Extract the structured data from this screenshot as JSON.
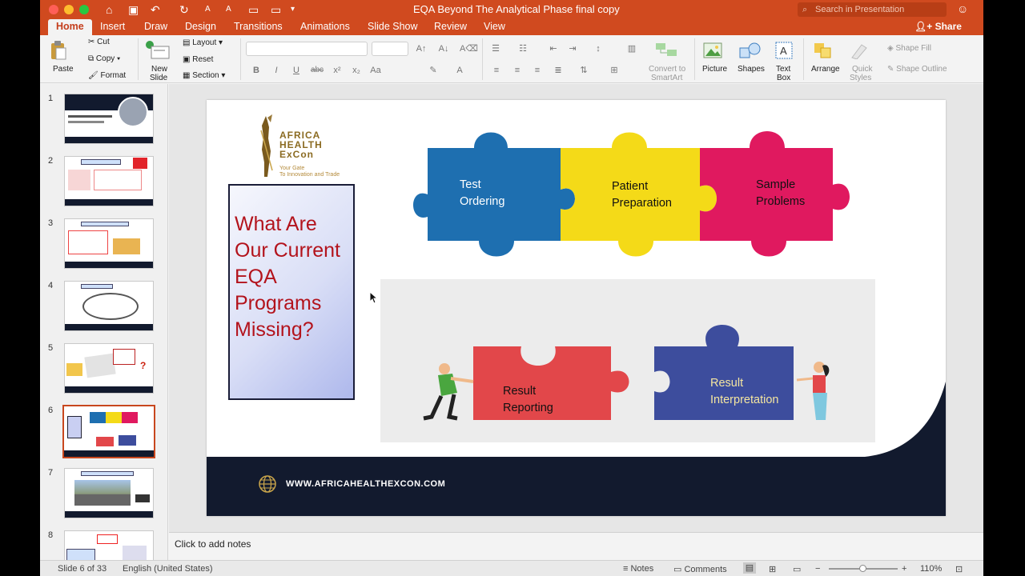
{
  "window": {
    "title": "EQA Beyond The Analytical Phase final copy",
    "search_placeholder": "Search in Presentation",
    "share_label": "Share"
  },
  "tabs": [
    "Home",
    "Insert",
    "Draw",
    "Design",
    "Transitions",
    "Animations",
    "Slide Show",
    "Review",
    "View"
  ],
  "active_tab": "Home",
  "ribbon": {
    "paste": "Paste",
    "cut": "Cut",
    "copy": "Copy",
    "format": "Format",
    "new_slide_1": "New",
    "new_slide_2": "Slide",
    "layout": "Layout",
    "reset": "Reset",
    "section": "Section",
    "convert_1": "Convert to",
    "convert_2": "SmartArt",
    "picture": "Picture",
    "shapes": "Shapes",
    "textbox_1": "Text",
    "textbox_2": "Box",
    "arrange": "Arrange",
    "quick_styles_1": "Quick",
    "quick_styles_2": "Styles",
    "shape_fill": "Shape Fill",
    "shape_outline": "Shape Outline"
  },
  "thumbnails": {
    "numbers": [
      "1",
      "2",
      "3",
      "4",
      "5",
      "6",
      "7",
      "8"
    ],
    "selected": "6"
  },
  "slide": {
    "logo_line1": "AFRICA",
    "logo_line2": "HEALTH",
    "logo_line3": "ExCon",
    "logo_tag1": "Your Gate",
    "logo_tag2": "To Innovation and Trade",
    "question": "What Are Our Current EQA Programs Missing?",
    "puzzle": {
      "piece1": "Test\nOrdering",
      "piece2": "Patient\nPreparation",
      "piece3": "Sample\nProblems",
      "piece4": "Result\nReporting",
      "piece5": "Result\nInterpretation"
    },
    "footer_url": "WWW.AFRICAHEALTHEXCON.COM"
  },
  "colors": {
    "ribbon_orange": "#d04a1f",
    "puzzle_blue": "#1e6fb0",
    "puzzle_yellow": "#f4da18",
    "puzzle_pink": "#e0195f",
    "puzzle_red": "#e2474a",
    "puzzle_navy": "#3d4d9d",
    "footer_navy": "#121a2e",
    "question_red": "#b3131c"
  },
  "notes": {
    "placeholder": "Click to add notes"
  },
  "statusbar": {
    "slide_info": "Slide 6 of 33",
    "language": "English (United States)",
    "notes_label": "Notes",
    "comments_label": "Comments",
    "zoom": "110%"
  }
}
